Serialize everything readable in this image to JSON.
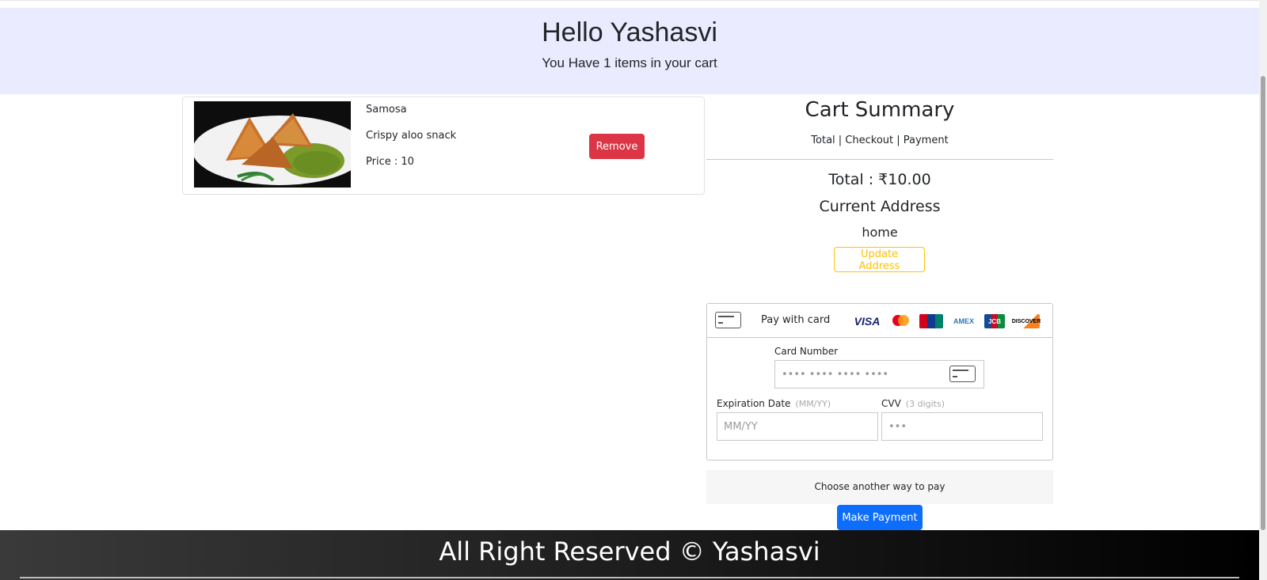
{
  "hero": {
    "greeting": "Hello Yashasvi",
    "subtitle": "You Have 1 items in your cart"
  },
  "cart_items": [
    {
      "name": "Samosa",
      "description": "Crispy aloo snack",
      "price_text": "Price : 10",
      "remove_label": "Remove",
      "image": "samosa-photo"
    }
  ],
  "summary": {
    "title": "Cart Summary",
    "steps": "Total | Checkout | Payment",
    "total": "Total : ₹10.00",
    "address_title": "Current Address",
    "address": "home",
    "update_label": "Update Address"
  },
  "payment": {
    "pay_with_card": "Pay with card",
    "brands": [
      "VISA",
      "mastercard",
      "UnionPay",
      "AMEX",
      "JCB",
      "DISCOVER"
    ],
    "card_number_label": "Card Number",
    "card_number_placeholder": "•••• •••• •••• ••••",
    "expiry_label": "Expiration Date",
    "expiry_hint": "(MM/YY)",
    "expiry_placeholder": "MM/YY",
    "cvv_label": "CVV",
    "cvv_hint": "(3 digits)",
    "cvv_placeholder": "•••",
    "another_way": "Choose another way to pay",
    "make_payment": "Make Payment"
  },
  "footer": {
    "text": "All Right Reserved © Yashasvi"
  },
  "colors": {
    "hero_bg": "#ebebff",
    "remove": "#dc3545",
    "update": "#ffc107",
    "primary": "#0d6efd"
  }
}
